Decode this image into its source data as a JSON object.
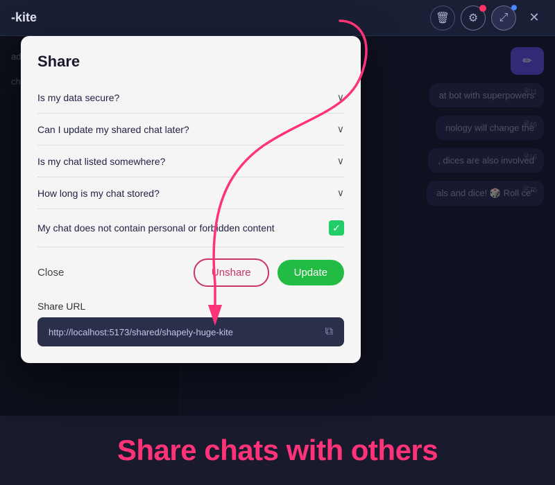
{
  "app": {
    "title": "-kite",
    "close_label": "×"
  },
  "topbar": {
    "delete_icon": "🗑",
    "gear_icon": "⚙",
    "share_icon": "⤢",
    "close_icon": "✕"
  },
  "background": {
    "sidebar_items": [
      "ad",
      "ch"
    ],
    "bubbles": [
      {
        "num": "11",
        "text": "at bot with superpowers"
      },
      {
        "num": "46",
        "text": "nology will change the"
      },
      {
        "num": "16",
        "text": ", dices are also involved"
      },
      {
        "num": "75",
        "text": "als and dice! 🎲  Roll ce\""
      }
    ],
    "edit_icon": "✏"
  },
  "modal": {
    "title": "Share",
    "faq_items": [
      {
        "label": "Is my data secure?",
        "chevron": "∨"
      },
      {
        "label": "Can I update my shared chat later?",
        "chevron": "∨"
      },
      {
        "label": "Is my chat listed somewhere?",
        "chevron": "∨"
      },
      {
        "label": "How long is my chat stored?",
        "chevron": "∨"
      }
    ],
    "checkbox_label": "My chat does not contain personal or forbidden content",
    "checkbox_checked": true,
    "close_label": "Close",
    "unshare_label": "Unshare",
    "update_label": "Update",
    "share_url_label": "Share URL",
    "share_url_value": "http://localhost:5173/shared/shapely-huge-kite",
    "copy_icon": "⧉"
  },
  "bottom": {
    "title": "Share chats with others"
  }
}
